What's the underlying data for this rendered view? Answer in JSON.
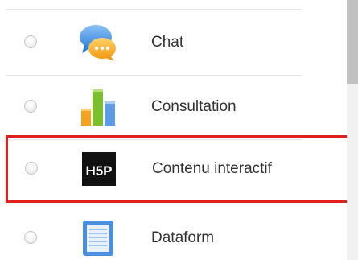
{
  "activities": [
    {
      "label": "Chat",
      "icon": "chat-bubbles-icon"
    },
    {
      "label": "Consultation",
      "icon": "bar-chart-icon"
    },
    {
      "label": "Contenu interactif",
      "icon": "h5p-icon",
      "icon_text": "H5P",
      "highlighted": true,
      "highlight_color": "#e0201d"
    },
    {
      "label": "Dataform",
      "icon": "document-icon"
    }
  ],
  "colors": {
    "highlight": "#e0201d",
    "chat_blue": "#3c8ee6",
    "chat_orange": "#f5a21e",
    "bar_orange": "#f5a21e",
    "bar_green": "#7bbf2e",
    "bar_blue": "#5c9be6",
    "h5p_bg": "#111111",
    "dataform_blue": "#4a8fe0"
  }
}
